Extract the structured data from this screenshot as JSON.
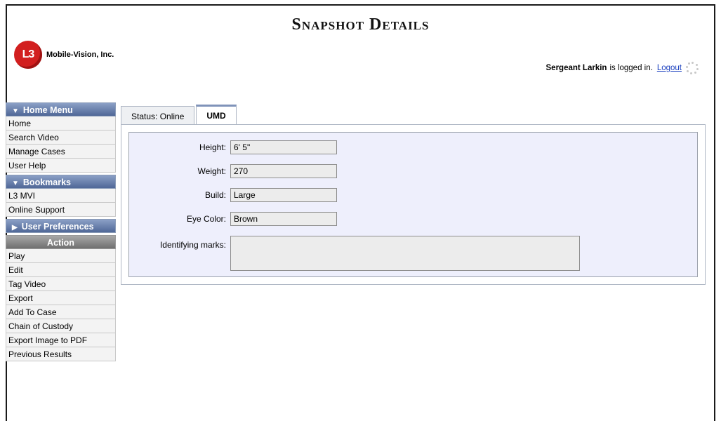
{
  "page": {
    "title": "Snapshot Details"
  },
  "logo": {
    "mark": "L3",
    "company": "Mobile-Vision, Inc."
  },
  "user": {
    "name": "Sergeant Larkin",
    "status_text": "is logged in.",
    "logout_label": "Logout"
  },
  "sidebar": {
    "home_menu": {
      "label": "Home Menu",
      "expanded": true,
      "items": [
        "Home",
        "Search Video",
        "Manage Cases",
        "User Help"
      ]
    },
    "bookmarks": {
      "label": "Bookmarks",
      "expanded": true,
      "items": [
        "L3 MVI",
        "Online Support"
      ]
    },
    "user_preferences": {
      "label": "User Preferences",
      "expanded": false
    },
    "action": {
      "label": "Action",
      "items": [
        "Play",
        "Edit",
        "Tag Video",
        "Export",
        "Add To Case",
        "Chain of Custody",
        "Export Image to PDF",
        "Previous Results"
      ]
    }
  },
  "tabs": [
    {
      "label": "Status: Online",
      "active": false
    },
    {
      "label": "UMD",
      "active": true
    }
  ],
  "umd": {
    "height": {
      "label": "Height:",
      "value": "6' 5\""
    },
    "weight": {
      "label": "Weight:",
      "value": "270"
    },
    "build": {
      "label": "Build:",
      "value": "Large"
    },
    "eye_color": {
      "label": "Eye Color:",
      "value": "Brown"
    },
    "identifying_marks": {
      "label": "Identifying marks:",
      "value": ""
    }
  },
  "icons": {
    "expand_down": "triangle-down-icon",
    "collapsed": "triangle-right-icon",
    "loading": "spinner-icon"
  },
  "colors": {
    "menu_header": "#5c73a3",
    "panel_bg": "#eeeffc",
    "link": "#1a3fbf",
    "logo": "#d21f1f"
  }
}
